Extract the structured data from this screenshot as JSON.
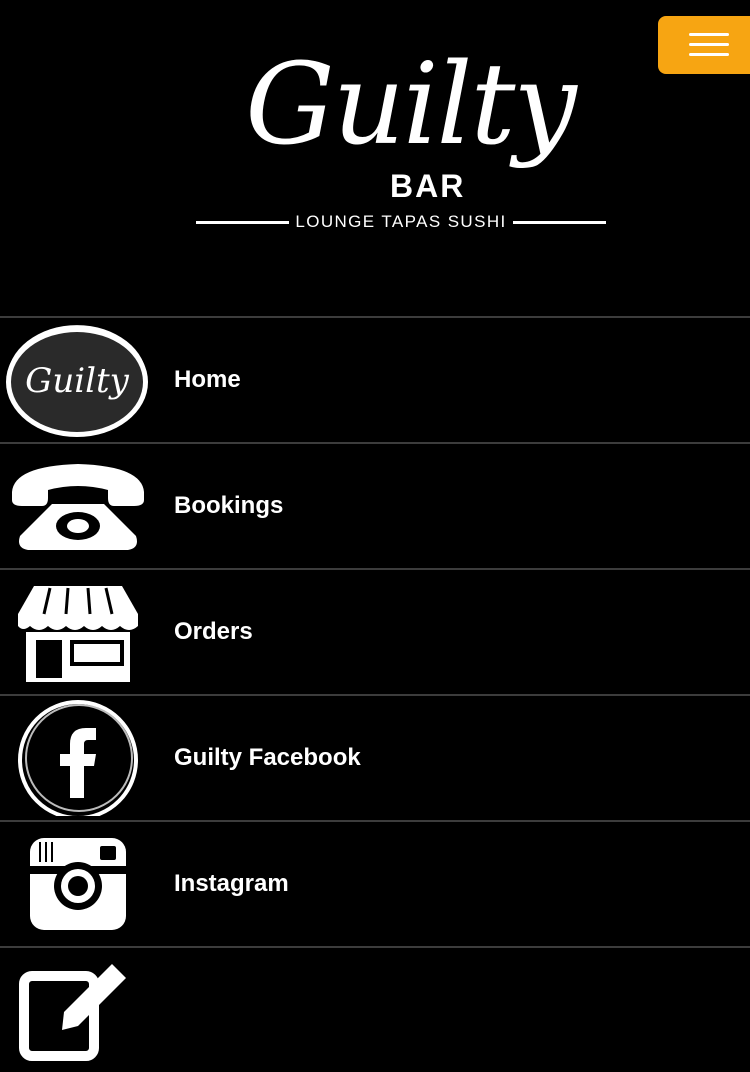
{
  "header": {
    "logo_script": "Guilty",
    "logo_bar": "BAR",
    "tagline": "LOUNGE TAPAS SUSHI"
  },
  "menu_button": {
    "icon": "hamburger-icon",
    "color": "#f7a512"
  },
  "menu_items": [
    {
      "label": "Home",
      "icon": "guilty-logo-icon",
      "icon_text": "Guilty"
    },
    {
      "label": "Bookings",
      "icon": "telephone-icon"
    },
    {
      "label": "Orders",
      "icon": "storefront-icon"
    },
    {
      "label": "Guilty Facebook",
      "icon": "facebook-icon"
    },
    {
      "label": "Instagram",
      "icon": "instagram-icon"
    },
    {
      "label": "",
      "icon": "edit-icon"
    }
  ]
}
